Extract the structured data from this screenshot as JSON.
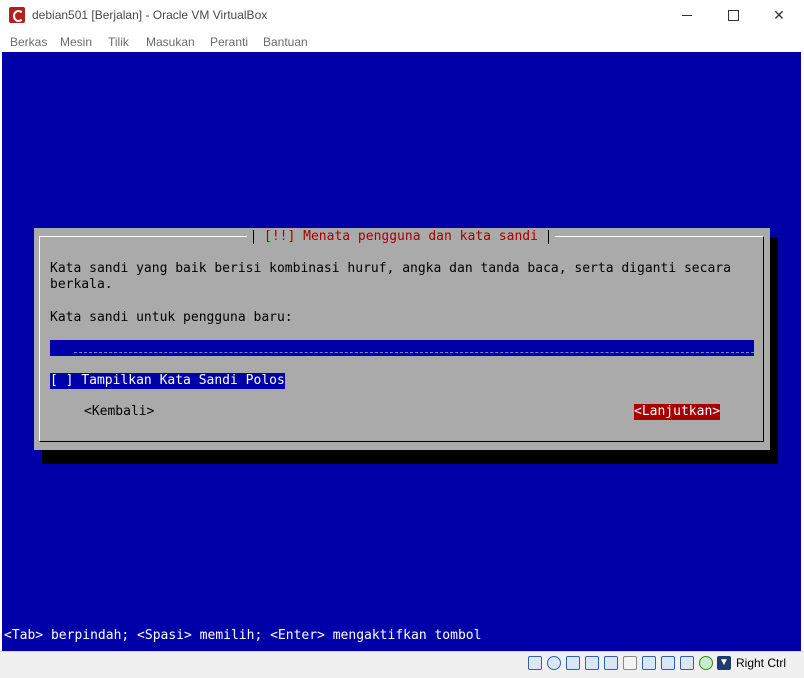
{
  "window": {
    "title": "debian501 [Berjalan] - Oracle VM VirtualBox",
    "min_glyph": "",
    "max_glyph": "",
    "close_glyph": "✕"
  },
  "menu": [
    "Berkas",
    "Mesin",
    "Tilik",
    "Masukan",
    "Peranti",
    "Bantuan"
  ],
  "dialog": {
    "title": "[!!] Menata pengguna dan kata sandi",
    "description_line1": "Kata sandi yang baik berisi kombinasi huruf, angka dan tanda baca, serta diganti secara",
    "description_line2": "berkala.",
    "password_prompt": "Kata sandi untuk pengguna baru:",
    "password_value": "***",
    "show_password_checkbox": "[ ] Tampilkan Kata Sandi Polos",
    "back_button": "<Kembali>",
    "continue_button": "<Lanjutkan>"
  },
  "hint": "<Tab> berpindah; <Spasi> memilih; <Enter> mengaktifkan tombol",
  "statusbar": {
    "host_key_label": "Right Ctrl",
    "icons": [
      "hard-disk-icon",
      "optical-drive-icon",
      "audio-icon",
      "network-icon",
      "usb-icon",
      "shared-folders-icon",
      "display-icon",
      "video-capture-icon",
      "virtualization-icon",
      "mouse-integration-icon",
      "keyboard-arrow-icon"
    ]
  },
  "colors": {
    "vm_background": "#0000a8",
    "dialog_background": "#aaaaaa",
    "dialog_title": "#a80000",
    "selected_button": "#a80000"
  }
}
